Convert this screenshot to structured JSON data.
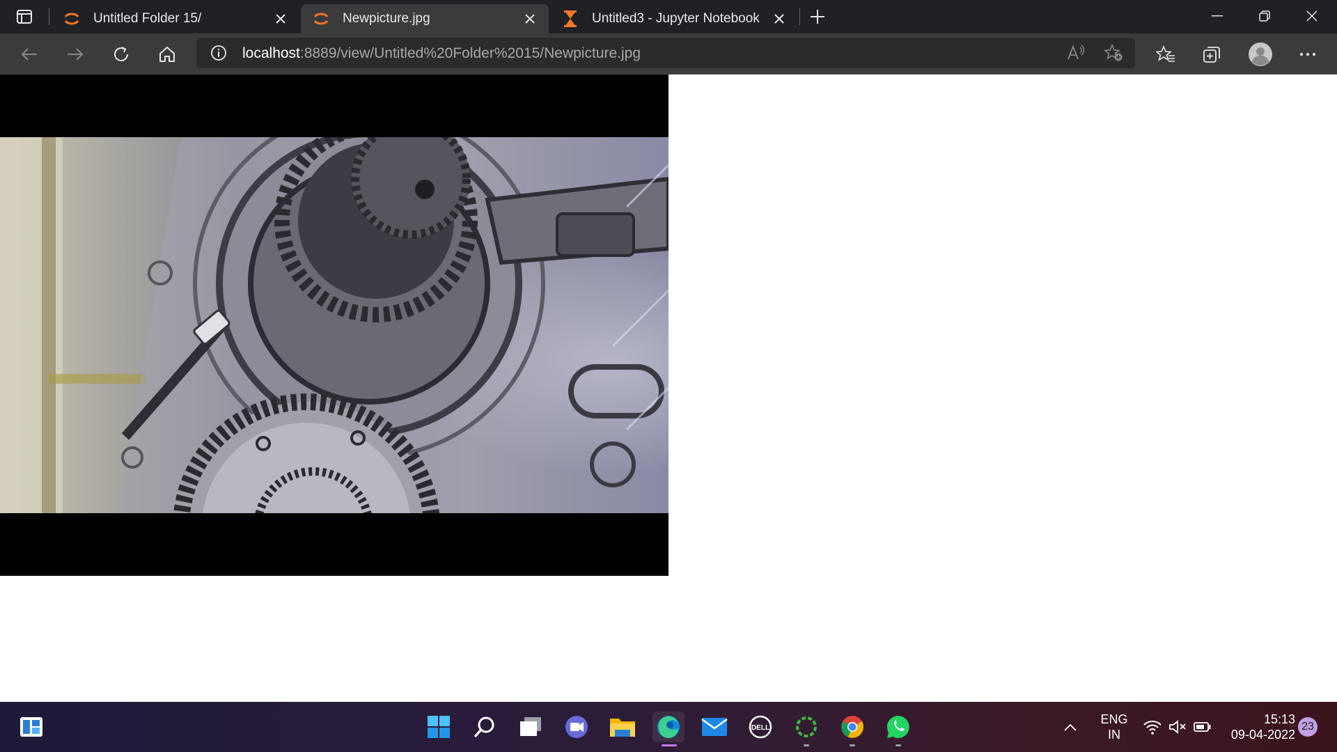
{
  "browser": {
    "tabs": [
      {
        "title": "Untitled Folder 15/",
        "icon": "jupyter-icon",
        "active": false
      },
      {
        "title": "Newpicture.jpg",
        "icon": "jupyter-icon",
        "active": true
      },
      {
        "title": "Untitled3 - Jupyter Notebook",
        "icon": "hourglass-busy-icon",
        "active": false
      }
    ],
    "address_bar": {
      "host": "localhost",
      "path": ":8889/view/Untitled%20Folder%2015/Newpicture.jpg"
    }
  },
  "viewer": {
    "image_name": "Newpicture.jpg",
    "image_subject": "grayscale-gear-mechanism-photo"
  },
  "taskbar": {
    "apps": [
      "widgets-icon",
      "start-icon",
      "search-icon",
      "task-view-icon",
      "chat-icon",
      "file-explorer-icon",
      "edge-icon",
      "mail-icon",
      "dell-icon",
      "loading-app-icon",
      "chrome-icon",
      "whatsapp-icon"
    ],
    "tray": {
      "language": "ENG",
      "region": "IN",
      "time": "15:13",
      "date": "09-04-2022",
      "notification_count": "23"
    }
  },
  "colors": {
    "tabbar_bg": "#202124",
    "toolbar_bg": "#3b3b3b",
    "jupyter_orange": "#f37726",
    "accent_purple": "#c77dff"
  }
}
